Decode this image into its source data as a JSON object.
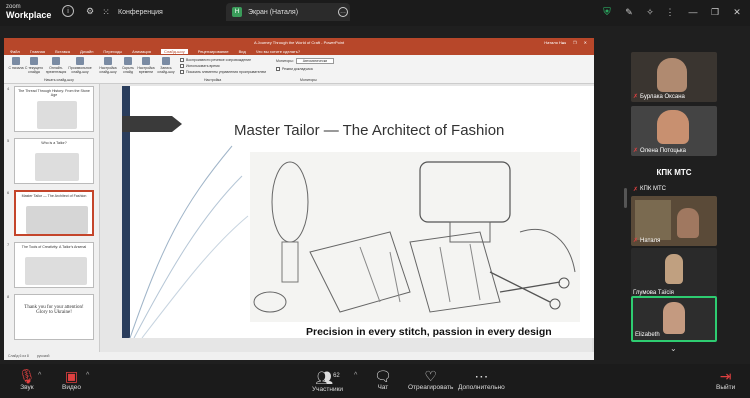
{
  "app": {
    "logo_small": "zoom",
    "logo_big": "Workplace"
  },
  "tabs": [
    {
      "label": "Конференция"
    },
    {
      "label": "Экран (Наталя)"
    }
  ],
  "share_badge": "Н",
  "powerpoint": {
    "doc_title": "A Journey Through the World of Craft - PowerPoint",
    "user": "Наталя Нач",
    "ribbon_tabs": [
      "Файл",
      "Главная",
      "Вставка",
      "Дизайн",
      "Переходы",
      "Анимация",
      "Слайд-шоу",
      "Рецензирование",
      "Вид",
      "Что вы хотите сделать?"
    ],
    "selected_ribbon_tab": "Слайд-шоу",
    "ribbon_buttons": [
      "С начала",
      "С текущего слайда",
      "Онлайн-презентация",
      "Произвольное слайд-шоу",
      "Настройка слайд-шоу",
      "Скрыть слайд",
      "Настройка времени",
      "Запись слайд-шоу"
    ],
    "ribbon_checks": [
      "Воспроизвести речевое сопровождение",
      "Использовать время",
      "Показать элементы управления проигрывателем"
    ],
    "monitor_label": "Мониторы:",
    "monitor_value": "Автоматически",
    "presenter_label": "Режим докладчика",
    "ribbon_groups": [
      "Начать слайд-шоу",
      "Настройка",
      "Мониторы"
    ],
    "thumbnails": [
      {
        "num": "4",
        "title": "The Thread Through History: From the Stone Age"
      },
      {
        "num": "5",
        "title": "Who is a Tailor?"
      },
      {
        "num": "6",
        "title": "Master Tailor — The Architect of Fashion"
      },
      {
        "num": "7",
        "title": "The Tools of Creativity: A Tailor's Arsenal"
      },
      {
        "num": "8",
        "title": "Thank you for your attention! Glory to Ukraine!"
      }
    ],
    "status_left": "Слайд 6 из 8",
    "status_lang": "русский",
    "slide": {
      "title": "Master Tailor — The Architect of Fashion",
      "caption": "Precision in every stitch, passion in every design"
    }
  },
  "participants": [
    {
      "name": "Бурлака Оксана",
      "muted": true
    },
    {
      "name": "Олена Потоцька",
      "muted": true
    },
    {
      "name": "КПК МТС",
      "muted": false,
      "header": true
    },
    {
      "name": "КПК МТС",
      "muted": true
    },
    {
      "name": "Наталя",
      "muted": true
    },
    {
      "name": "Глумова Таїсія",
      "muted": false
    },
    {
      "name": "Elizabeth",
      "muted": false
    }
  ],
  "bottom": {
    "audio": "Звук",
    "video": "Видео",
    "participants": "Участники",
    "participants_count": "62",
    "chat": "Чат",
    "react": "Отреагировать",
    "more": "Дополнительно",
    "leave": "Выйти"
  },
  "colors": {
    "ppt_accent": "#b7472a",
    "zoom_bg": "#1b1b1b",
    "active_speaker": "#2ecc71",
    "muted_red": "#e04040"
  }
}
